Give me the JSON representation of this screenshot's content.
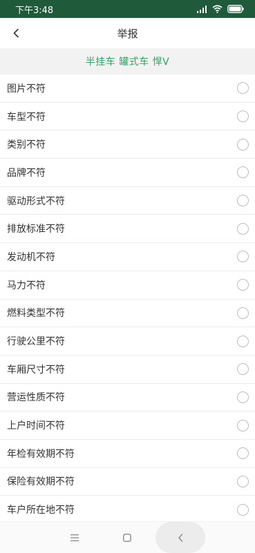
{
  "status_bar": {
    "time": "下午3:48"
  },
  "nav": {
    "title": "举报"
  },
  "vehicle": {
    "label": "半挂车 罐式车 悍V"
  },
  "report_options": [
    {
      "label": "图片不符"
    },
    {
      "label": "车型不符"
    },
    {
      "label": "类别不符"
    },
    {
      "label": "品牌不符"
    },
    {
      "label": "驱动形式不符"
    },
    {
      "label": "排放标准不符"
    },
    {
      "label": "发动机不符"
    },
    {
      "label": "马力不符"
    },
    {
      "label": "燃料类型不符"
    },
    {
      "label": "行驶公里不符"
    },
    {
      "label": "车厢尺寸不符"
    },
    {
      "label": "营运性质不符"
    },
    {
      "label": "上户时间不符"
    },
    {
      "label": "年检有效期不符"
    },
    {
      "label": "保险有效期不符"
    },
    {
      "label": "车户所在地不符"
    }
  ],
  "colors": {
    "status_bar": "#1f5a3a",
    "accent": "#2fa465",
    "banner_bg": "#f2f2f2"
  },
  "icons": {
    "back": "chevron-left-icon",
    "signal": "signal-icon",
    "wifi": "wifi-icon",
    "battery": "battery-icon",
    "menu": "menu-icon",
    "home": "square-home-icon",
    "system_back": "system-back-icon"
  }
}
